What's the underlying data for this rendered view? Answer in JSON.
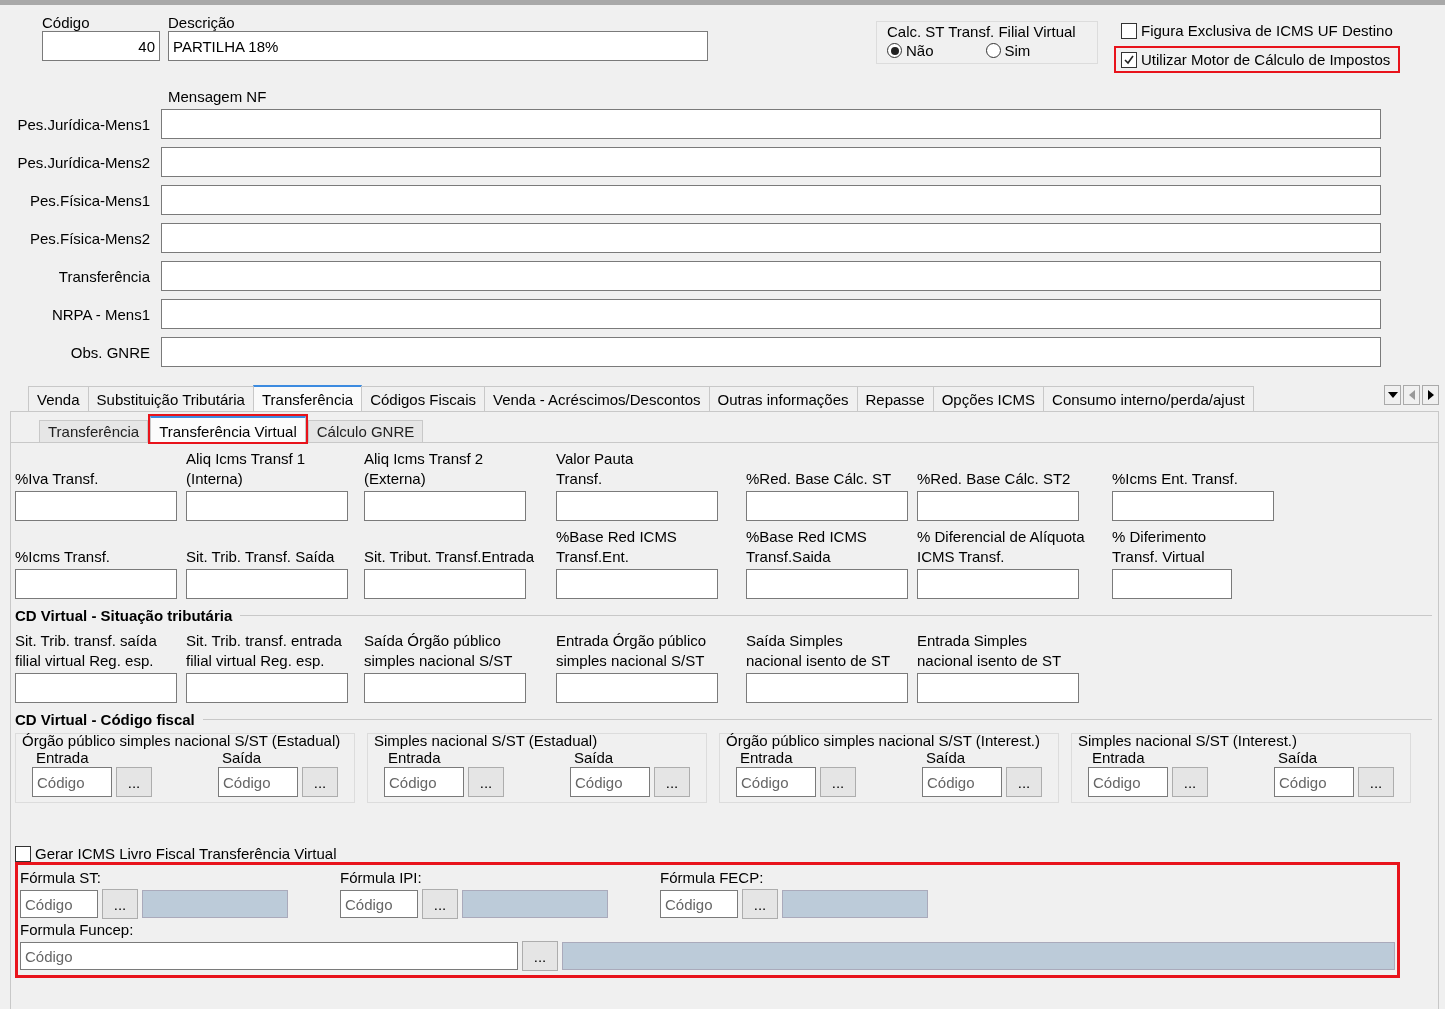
{
  "codigo": {
    "label": "Código",
    "value": "40"
  },
  "descricao": {
    "label": "Descrição",
    "value": "PARTILHA 18%"
  },
  "calc_st": {
    "title": "Calc. ST Transf. Filial Virtual",
    "options": [
      {
        "label": "Não",
        "selected": true
      },
      {
        "label": "Sim",
        "selected": false
      }
    ]
  },
  "options": [
    {
      "label": "Figura Exclusiva de ICMS UF Destino",
      "checked": false,
      "highlighted": false
    },
    {
      "label": "Utilizar Motor de Cálculo de Impostos",
      "checked": true,
      "highlighted": true
    }
  ],
  "mensagem_nf": {
    "title": "Mensagem NF",
    "fields": [
      {
        "label": "Pes.Jurídica-Mens1"
      },
      {
        "label": "Pes.Jurídica-Mens2"
      },
      {
        "label": "Pes.Física-Mens1"
      },
      {
        "label": "Pes.Física-Mens2"
      },
      {
        "label": "Transferência"
      },
      {
        "label": "NRPA - Mens1"
      },
      {
        "label": "Obs. GNRE"
      }
    ]
  },
  "tabs": [
    {
      "label": "Venda",
      "selected": false
    },
    {
      "label": "Substituição Tributária",
      "selected": false
    },
    {
      "label": "Transferência",
      "selected": true
    },
    {
      "label": "Códigos Fiscais",
      "selected": false
    },
    {
      "label": "Venda - Acréscimos/Descontos",
      "selected": false
    },
    {
      "label": "Outras informações",
      "selected": false
    },
    {
      "label": "Repasse",
      "selected": false
    },
    {
      "label": "Opções ICMS",
      "selected": false
    },
    {
      "label": "Consumo interno/perda/ajust",
      "selected": false
    }
  ],
  "subtabs": [
    {
      "label": "Transferência",
      "selected": false,
      "highlighted": false
    },
    {
      "label": "Transferência Virtual",
      "selected": true,
      "highlighted": true
    },
    {
      "label": "Cálculo GNRE",
      "selected": false,
      "highlighted": false
    }
  ],
  "transf_row_1": [
    {
      "label": "%Iva Transf."
    },
    {
      "label": "Aliq Icms Transf 1\n(Interna)"
    },
    {
      "label": "Aliq Icms Transf 2\n(Externa)"
    },
    {
      "label": "Valor Pauta\nTransf."
    },
    {
      "label": "%Red. Base Cálc. ST"
    },
    {
      "label": "%Red. Base Cálc. ST2"
    },
    {
      "label": "%Icms Ent. Transf."
    }
  ],
  "transf_row_2": [
    {
      "label": "%Icms Transf."
    },
    {
      "label": "Sit. Trib. Transf. Saída"
    },
    {
      "label": "Sit. Tribut. Transf.Entrada"
    },
    {
      "label": "%Base Red ICMS\nTransf.Ent."
    },
    {
      "label": "%Base Red ICMS\nTransf.Saida"
    },
    {
      "label": "% Diferencial de Alíquota\nICMS Transf."
    },
    {
      "label": "%  Diferimento\nTransf. Virtual"
    }
  ],
  "cd_situacao": {
    "title": "CD Virtual - Situação tributária",
    "fields": [
      {
        "label": "Sit. Trib. transf. saída\nfilial virtual Reg. esp."
      },
      {
        "label": "Sit. Trib. transf. entrada\nfilial virtual Reg. esp."
      },
      {
        "label": "Saída Órgão público\nsimples nacional S/ST"
      },
      {
        "label": "Entrada Órgão público\nsimples nacional S/ST"
      },
      {
        "label": "Saída Simples\nnacional isento de ST"
      },
      {
        "label": "Entrada Simples\nnacional isento de ST"
      }
    ]
  },
  "cd_codigo": {
    "title": "CD Virtual - Código fiscal",
    "groups": [
      {
        "title": "Órgão público simples nacional S/ST (Estadual)",
        "fields": [
          {
            "label": "Entrada",
            "placeholder": "Código",
            "button": "..."
          },
          {
            "label": "Saída",
            "placeholder": "Código",
            "button": "..."
          }
        ]
      },
      {
        "title": "Simples nacional S/ST (Estadual)",
        "fields": [
          {
            "label": "Entrada",
            "placeholder": "Código",
            "button": "..."
          },
          {
            "label": "Saída",
            "placeholder": "Código",
            "button": "..."
          }
        ]
      },
      {
        "title": "Órgão público simples nacional S/ST (Interest.)",
        "fields": [
          {
            "label": "Entrada",
            "placeholder": "Código",
            "button": "..."
          },
          {
            "label": "Saída",
            "placeholder": "Código",
            "button": "..."
          }
        ]
      },
      {
        "title": "Simples nacional S/ST (Interest.)",
        "fields": [
          {
            "label": "Entrada",
            "placeholder": "Código",
            "button": "..."
          },
          {
            "label": "Saída",
            "placeholder": "Código",
            "button": "..."
          }
        ]
      }
    ]
  },
  "gerar_icms": {
    "label": "Gerar ICMS Livro Fiscal Transferência Virtual",
    "checked": false
  },
  "formulas": {
    "highlighted": true,
    "items": [
      {
        "label": "Fórmula ST:",
        "placeholder": "Código",
        "button": "..."
      },
      {
        "label": "Fórmula IPI:",
        "placeholder": "Código",
        "button": "..."
      },
      {
        "label": "Fórmula FECP:",
        "placeholder": "Código",
        "button": "..."
      }
    ],
    "funcep": {
      "label": "Formula Funcep:",
      "placeholder": "Código",
      "button": "..."
    }
  }
}
